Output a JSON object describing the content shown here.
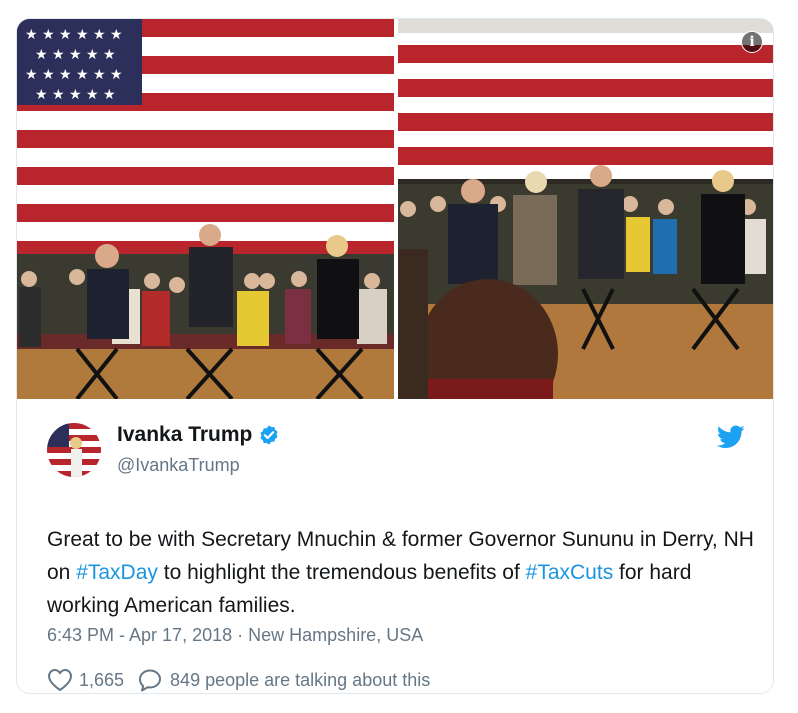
{
  "tweet": {
    "display_name": "Ivanka Trump",
    "handle": "@IvankaTrump",
    "text_parts": [
      "Great to be with Secretary Mnuchin & former Governor Sununu in Derry, NH on ",
      "#TaxDay",
      " to highlight the tremendous benefits of ",
      "#TaxCuts",
      " for hard working American families."
    ],
    "time": "6:43 PM - Apr 17, 2018",
    "separator": "·",
    "location": "New Hampshire, USA",
    "like_count": "1,665",
    "conversation_text": "849 people are talking about this"
  },
  "icons": {
    "info": "info-icon",
    "verified": "verified-badge-icon",
    "bird": "twitter-bird-icon",
    "like": "heart-icon",
    "reply": "speech-bubble-icon"
  },
  "colors": {
    "text": "#14171a",
    "secondary": "#657786",
    "link": "#1b95e0",
    "border": "#e1e8ed"
  }
}
